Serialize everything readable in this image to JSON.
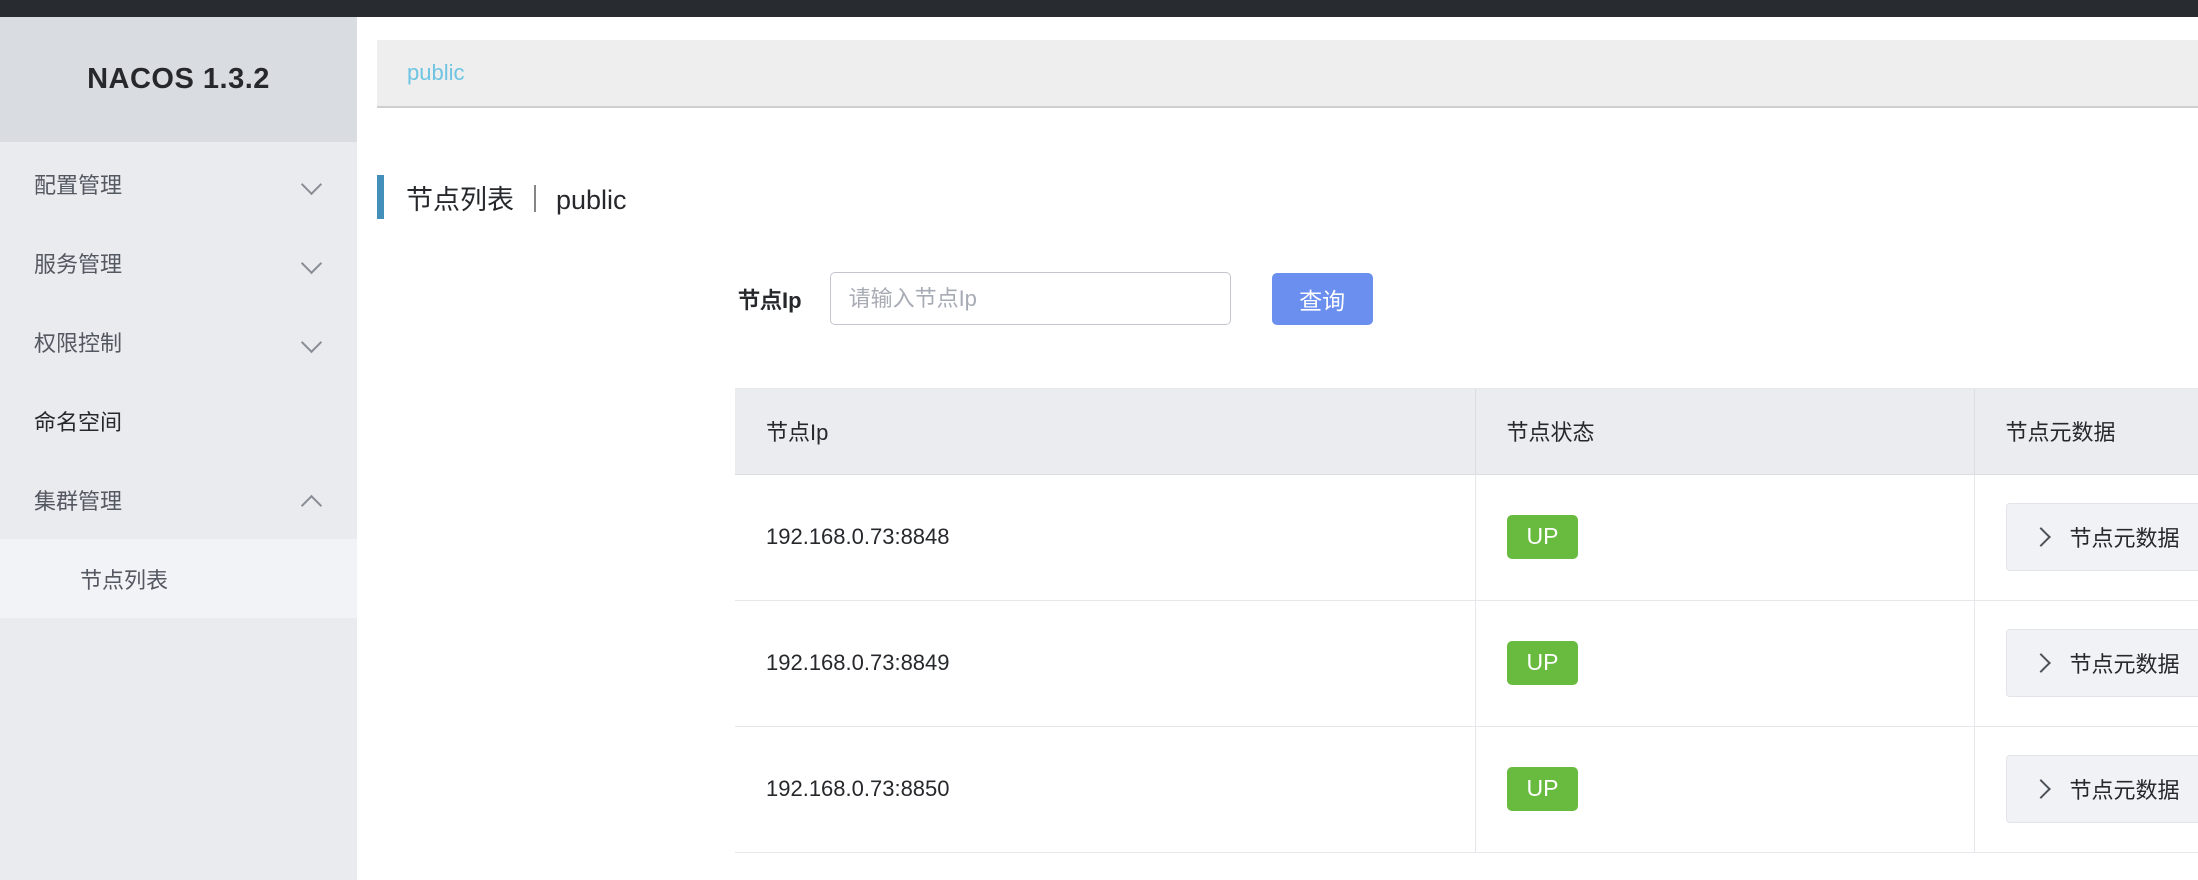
{
  "topbar": {
    "present": true
  },
  "sidebar": {
    "brand": "NACOS 1.3.2",
    "items": [
      {
        "label": "配置管理",
        "icon": "chevron-down-icon",
        "expanded": false
      },
      {
        "label": "服务管理",
        "icon": "chevron-down-icon",
        "expanded": false
      },
      {
        "label": "权限控制",
        "icon": "chevron-down-icon",
        "expanded": false
      },
      {
        "label": "命名空间",
        "icon": "",
        "expanded": false
      },
      {
        "label": "集群管理",
        "icon": "chevron-up-icon",
        "expanded": true
      }
    ],
    "subitems": [
      {
        "label": "节点列表",
        "active": true
      }
    ]
  },
  "breadcrumb": {
    "link": "public"
  },
  "page": {
    "title": "节点列表 ｜ public",
    "accent_color": "#4290ba"
  },
  "search": {
    "label": "节点Ip",
    "placeholder": "请输入节点Ip",
    "value": "",
    "button_label": "查询",
    "button_color": "#6a8fee"
  },
  "table": {
    "columns": [
      "节点Ip",
      "节点状态",
      "节点元数据"
    ],
    "rows": [
      {
        "ip": "192.168.0.73:8848",
        "status": "UP",
        "metadata_label": "节点元数据",
        "metadata_icon": "chevron-right-icon"
      },
      {
        "ip": "192.168.0.73:8849",
        "status": "UP",
        "metadata_label": "节点元数据",
        "metadata_icon": "chevron-right-icon"
      },
      {
        "ip": "192.168.0.73:8850",
        "status": "UP",
        "metadata_label": "节点元数据",
        "metadata_icon": "chevron-right-icon"
      }
    ],
    "status_color": "#68bb3f"
  }
}
